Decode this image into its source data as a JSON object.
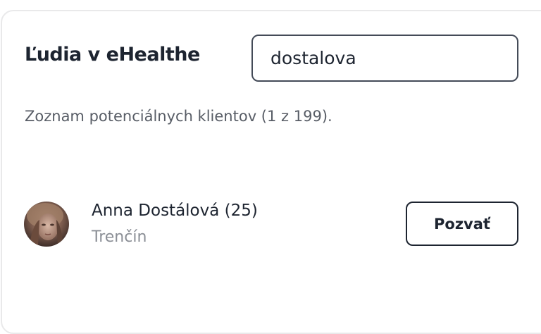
{
  "header": {
    "title": "Ľudia v eHealthe"
  },
  "search": {
    "value": "dostalova"
  },
  "summary": {
    "text": "Zoznam potenciálnych klientov (1 z 199)."
  },
  "results": [
    {
      "name": "Anna Dostálová (25)",
      "city": "Trenčín",
      "action_label": "Pozvať"
    }
  ],
  "colors": {
    "text_primary": "#1d2430",
    "text_secondary": "#585d66",
    "text_muted": "#8b8f96",
    "border": "#e9e9ea"
  }
}
